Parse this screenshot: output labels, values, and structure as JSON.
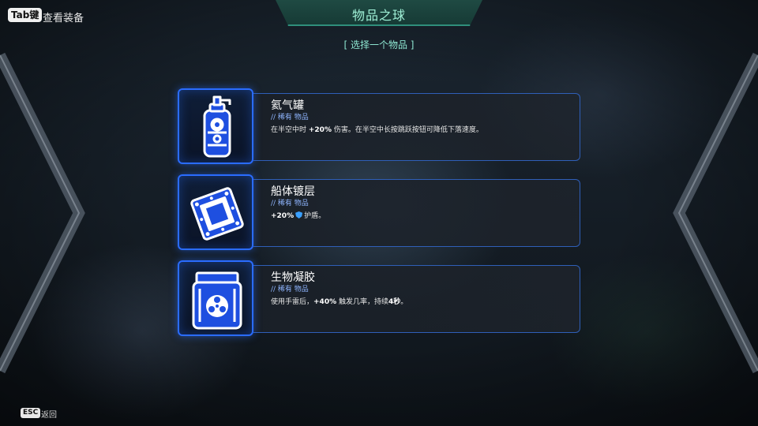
{
  "header": {
    "title": "物品之球",
    "subtitle": "[ 选择一个物品 ]"
  },
  "tab_hint": {
    "key": "Tab键",
    "label": "查看装备"
  },
  "esc_hint": {
    "key": "ESC",
    "label": "返回"
  },
  "items": [
    {
      "name": "氦气罐",
      "rarity": "// 稀有 物品",
      "desc_parts": [
        "在半空中时 ",
        "+20%",
        " 伤害。在半空中长按跳跃按钮可降低下落速度。"
      ],
      "icon": "gas-canister-icon"
    },
    {
      "name": "船体镀层",
      "rarity": "// 稀有 物品",
      "desc_parts": [
        "+20%",
        "护盾。"
      ],
      "icon": "hull-plating-icon"
    },
    {
      "name": "生物凝胶",
      "rarity": "// 稀有 物品",
      "desc_parts": [
        "使用手雷后，",
        "+40%",
        " 触发几率，持续",
        "4秒",
        "。"
      ],
      "icon": "biohazard-container-icon"
    }
  ],
  "colors": {
    "accent_blue": "#2a6cff",
    "accent_teal": "#9ff0d6",
    "rarity": "#8fb5ff"
  }
}
